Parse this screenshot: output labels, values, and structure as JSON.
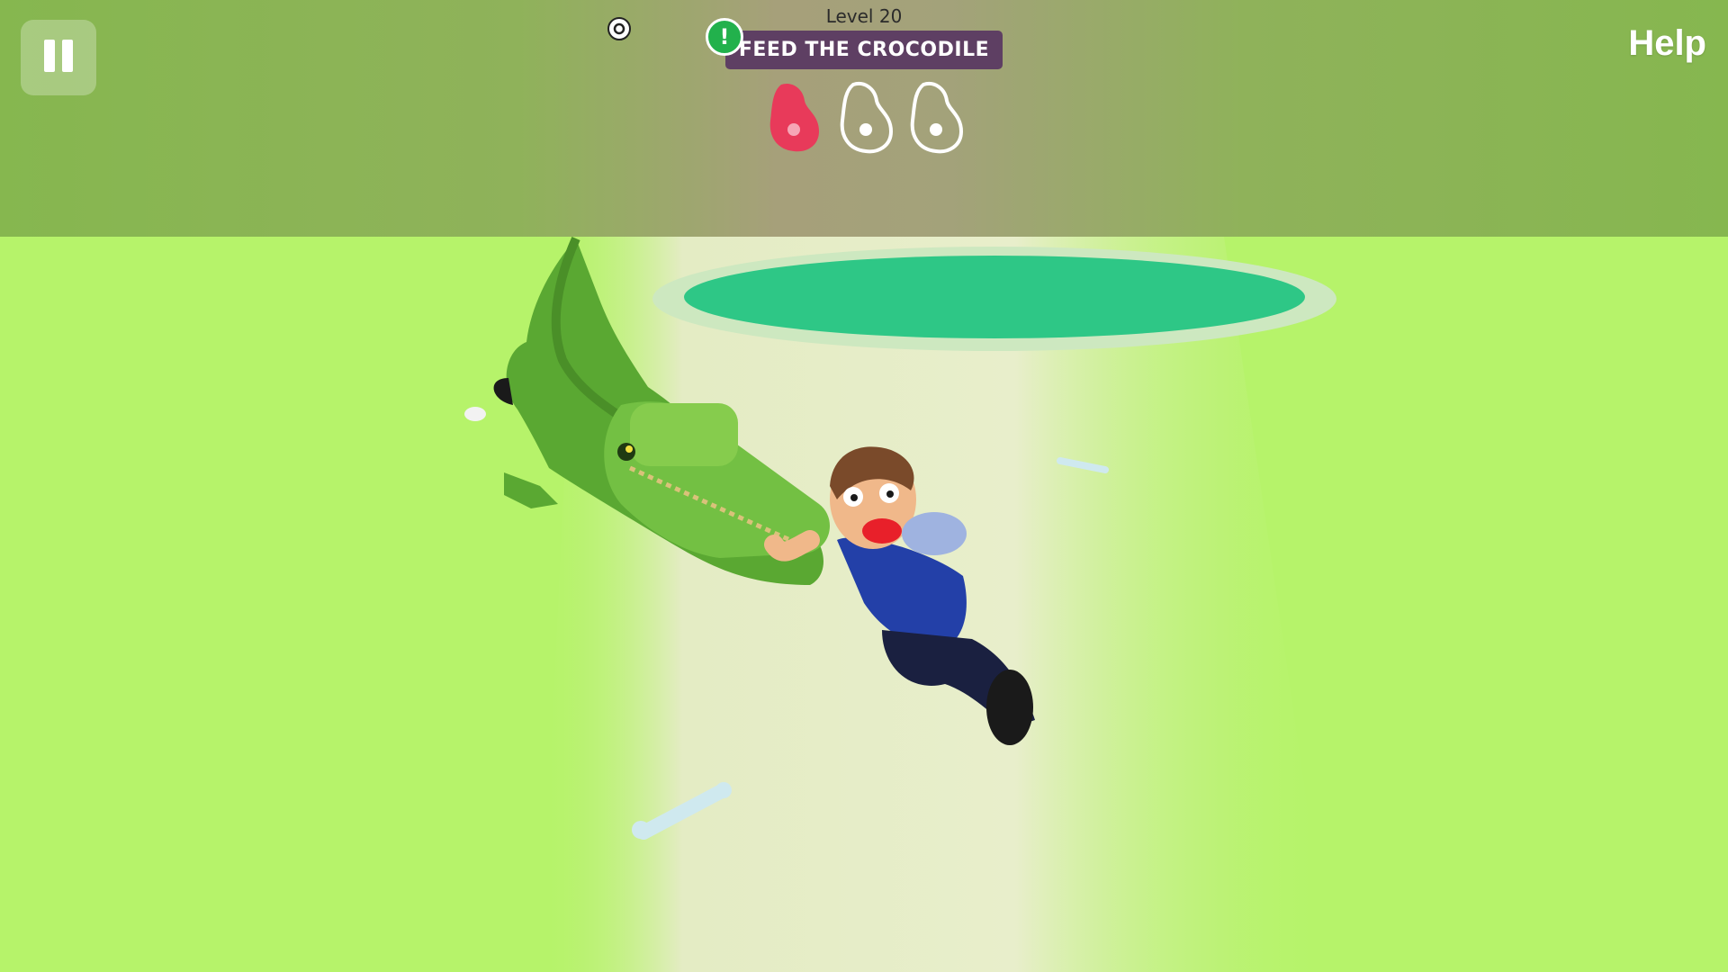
{
  "hud": {
    "level_label": "Level 20",
    "objective": "FEED THE CROCODILE",
    "help_label": "Help",
    "alert_glyph": "!",
    "pause_icon": "pause-icon",
    "settings_icon": "settings-icon"
  },
  "progress": {
    "meat_collected": 1,
    "meat_total": 3,
    "meat_icons": [
      {
        "name": "meat-icon",
        "state": "filled"
      },
      {
        "name": "meat-icon",
        "state": "empty"
      },
      {
        "name": "meat-icon",
        "state": "empty"
      }
    ]
  },
  "colors": {
    "grass": "#b6f36a",
    "sand": "#e4ecc4",
    "pond": "#2ec786",
    "banner": "#5e3f63",
    "meat_filled": "#e83a5a",
    "alert_green": "#22b14c"
  }
}
